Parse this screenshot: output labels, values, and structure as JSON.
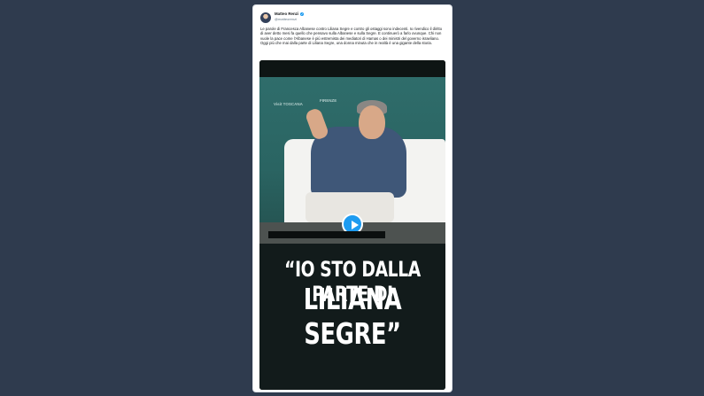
{
  "tweet": {
    "author_name": "Matteo Renzi",
    "author_handle": "@matteorenzi",
    "body": [
      "Le parole di Francesca Albanese contro Liliana Segre e contro gli ostaggi sono indecenti. Io rivendico il diritto di aver detto mesi fa quello che pensavo sulla Albanese e sulla Segre. E continuerò a farlo ovunque. Chi non vuole la pace come l'Albanese è più estremista dei mediatori di Hamas o dei ministri del governo israeliano. Oggi più che mai dalla parte di Liliana Segre, una donna minuta che in realtà è una gigante della storia."
    ]
  },
  "video": {
    "caption_line1": "“IO STO DALLA PARTE DI",
    "caption_line2": "LILIANA SEGRE”",
    "backdrop_brand1": "Visit TOSCANA",
    "backdrop_brand2": "FIRENZE"
  },
  "colors": {
    "page_background": "#2f3b4e",
    "play_button": "#1d9bf0",
    "verified_badge": "#1d9bf0"
  },
  "icons": {
    "play": "play-icon",
    "verified": "verified-badge-icon"
  }
}
